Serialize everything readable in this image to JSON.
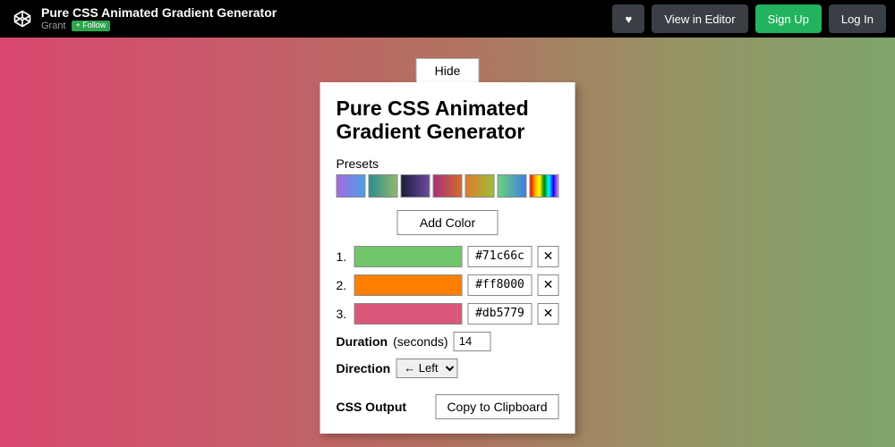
{
  "topbar": {
    "title": "Pure CSS Animated Gradient Generator",
    "author": "Grant",
    "follow_label": "+ Follow",
    "heart_icon": "♥",
    "view_editor_label": "View in Editor",
    "signup_label": "Sign Up",
    "login_label": "Log In"
  },
  "panel": {
    "hide_label": "Hide",
    "heading": "Pure CSS Animated Gradient Generator",
    "presets_label": "Presets",
    "add_color_label": "Add Color",
    "colors": [
      {
        "num": "1.",
        "hex": "#71c66c"
      },
      {
        "num": "2.",
        "hex": "#ff8000"
      },
      {
        "num": "3.",
        "hex": "#db5779"
      }
    ],
    "duration_label": "Duration",
    "duration_unit": "(seconds)",
    "duration_value": "14",
    "direction_label": "Direction",
    "direction_value": "← Left",
    "output_label": "CSS Output",
    "copy_label": "Copy to Clipboard"
  }
}
